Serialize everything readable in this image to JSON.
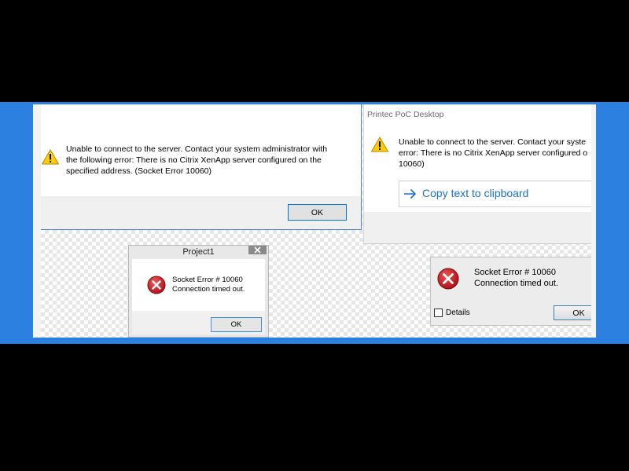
{
  "colors": {
    "page_background": "#000000",
    "band_blue": "#2c80df",
    "link_blue": "#1a73c8",
    "default_button_border": "#0078d7",
    "warning_yellow": "#ffcc00",
    "error_red": "#c8191f"
  },
  "dialogs": {
    "citrix_error": {
      "icon": "warning-icon",
      "message_lines": [
        "Unable to connect to the server. Contact your system administrator with",
        "the following error: There is no Citrix XenApp server configured on the",
        "specified address. (Socket Error 10060)"
      ],
      "ok_label": "OK"
    },
    "printec": {
      "title": "Printec PoC Desktop",
      "icon": "warning-icon",
      "message_lines": [
        "Unable to connect to the server. Contact your syste",
        "error: There is no Citrix XenApp server configured o",
        "10060)"
      ],
      "copy_icon": "arrow-right-icon",
      "copy_label": "Copy text to clipboard"
    },
    "project1": {
      "title": "Project1",
      "close_icon": "close-icon",
      "icon": "error-icon",
      "message_lines": [
        "Socket Error # 10060",
        "Connection timed out."
      ],
      "ok_label": "OK"
    },
    "socket_error": {
      "icon": "error-icon",
      "message_lines": [
        "Socket Error # 10060",
        "Connection timed out."
      ],
      "details_label": "Details",
      "details_checked": false,
      "ok_label": "OK"
    }
  }
}
